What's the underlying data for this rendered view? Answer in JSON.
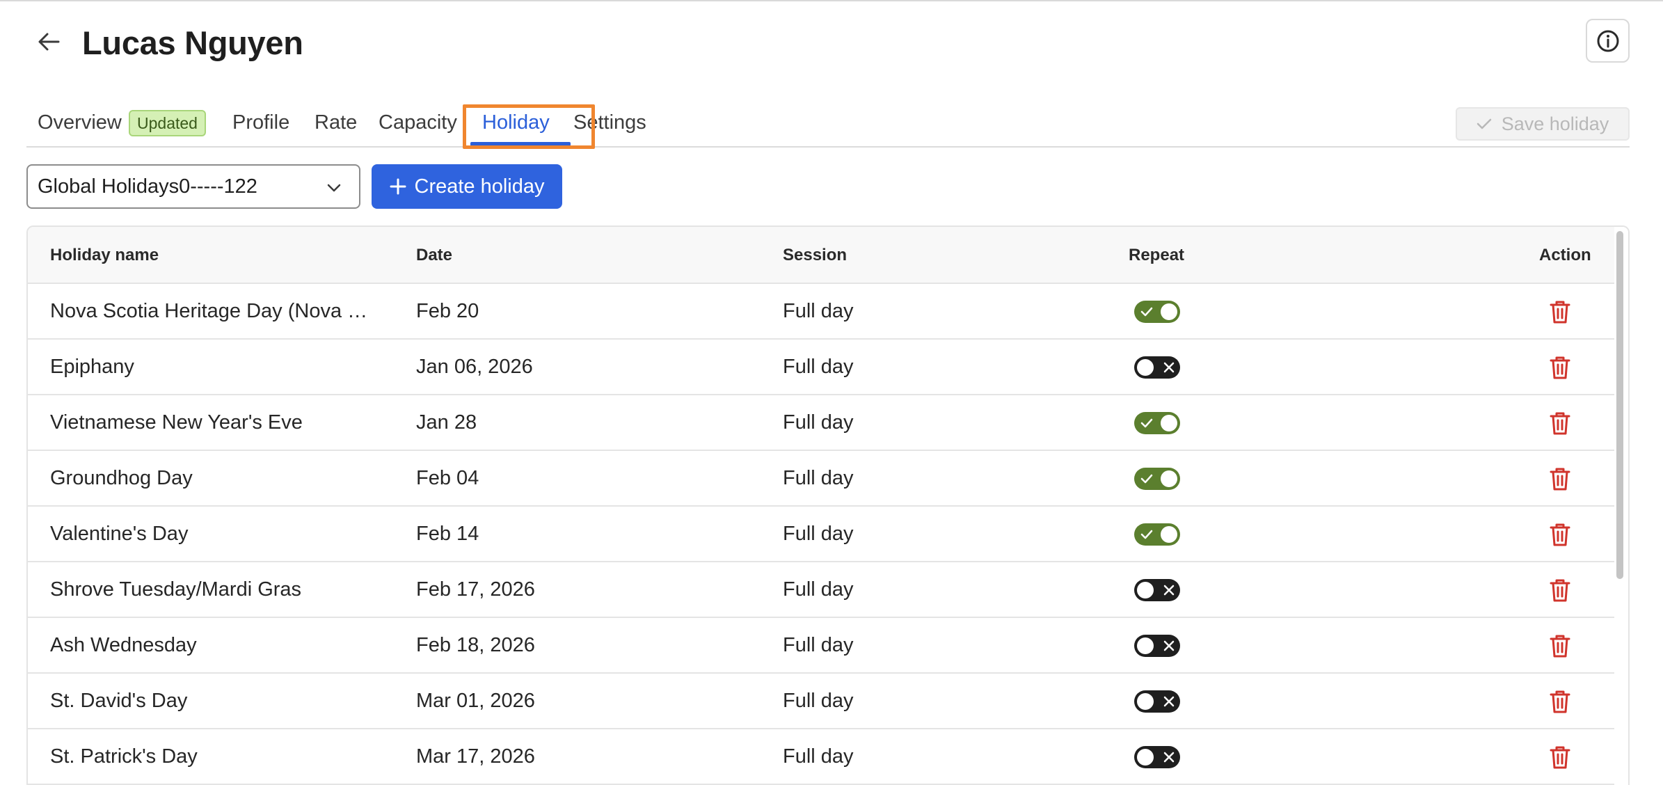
{
  "header": {
    "title": "Lucas Nguyen",
    "back_icon": "arrow-left-icon",
    "info_icon": "info-circle-icon"
  },
  "tabs": [
    {
      "label": "Overview",
      "badge": "Updated",
      "active": false
    },
    {
      "label": "Profile",
      "active": false
    },
    {
      "label": "Rate",
      "active": false
    },
    {
      "label": "Capacity",
      "active": false
    },
    {
      "label": "Holiday",
      "active": true
    },
    {
      "label": "Settings",
      "active": false
    }
  ],
  "actions": {
    "save_label": "Save holiday",
    "save_disabled": true
  },
  "toolbar": {
    "calendar_select_value": "Global Holidays0-----122",
    "create_label": "Create holiday"
  },
  "table": {
    "columns": [
      "Holiday name",
      "Date",
      "Session",
      "Repeat",
      "Action"
    ],
    "rows": [
      {
        "name": "Nova Scotia Heritage Day (Nova Scotia)",
        "date": "Feb 20",
        "session": "Full day",
        "repeat": true
      },
      {
        "name": "Epiphany",
        "date": "Jan 06, 2026",
        "session": "Full day",
        "repeat": false
      },
      {
        "name": "Vietnamese New Year's Eve",
        "date": "Jan 28",
        "session": "Full day",
        "repeat": true
      },
      {
        "name": "Groundhog Day",
        "date": "Feb 04",
        "session": "Full day",
        "repeat": true
      },
      {
        "name": "Valentine's Day",
        "date": "Feb 14",
        "session": "Full day",
        "repeat": true
      },
      {
        "name": "Shrove Tuesday/Mardi Gras",
        "date": "Feb 17, 2026",
        "session": "Full day",
        "repeat": false
      },
      {
        "name": "Ash Wednesday",
        "date": "Feb 18, 2026",
        "session": "Full day",
        "repeat": false
      },
      {
        "name": "St. David's Day",
        "date": "Mar 01, 2026",
        "session": "Full day",
        "repeat": false
      },
      {
        "name": "St. Patrick's Day",
        "date": "Mar 17, 2026",
        "session": "Full day",
        "repeat": false
      }
    ]
  },
  "colors": {
    "accent": "#2b5fd9",
    "primary_button": "#2f63de",
    "toggle_on": "#5b7f2e",
    "toggle_off": "#1f1f1f",
    "delete": "#d0342c",
    "highlight": "#f0862f",
    "badge_bg": "#d5f0b5"
  }
}
